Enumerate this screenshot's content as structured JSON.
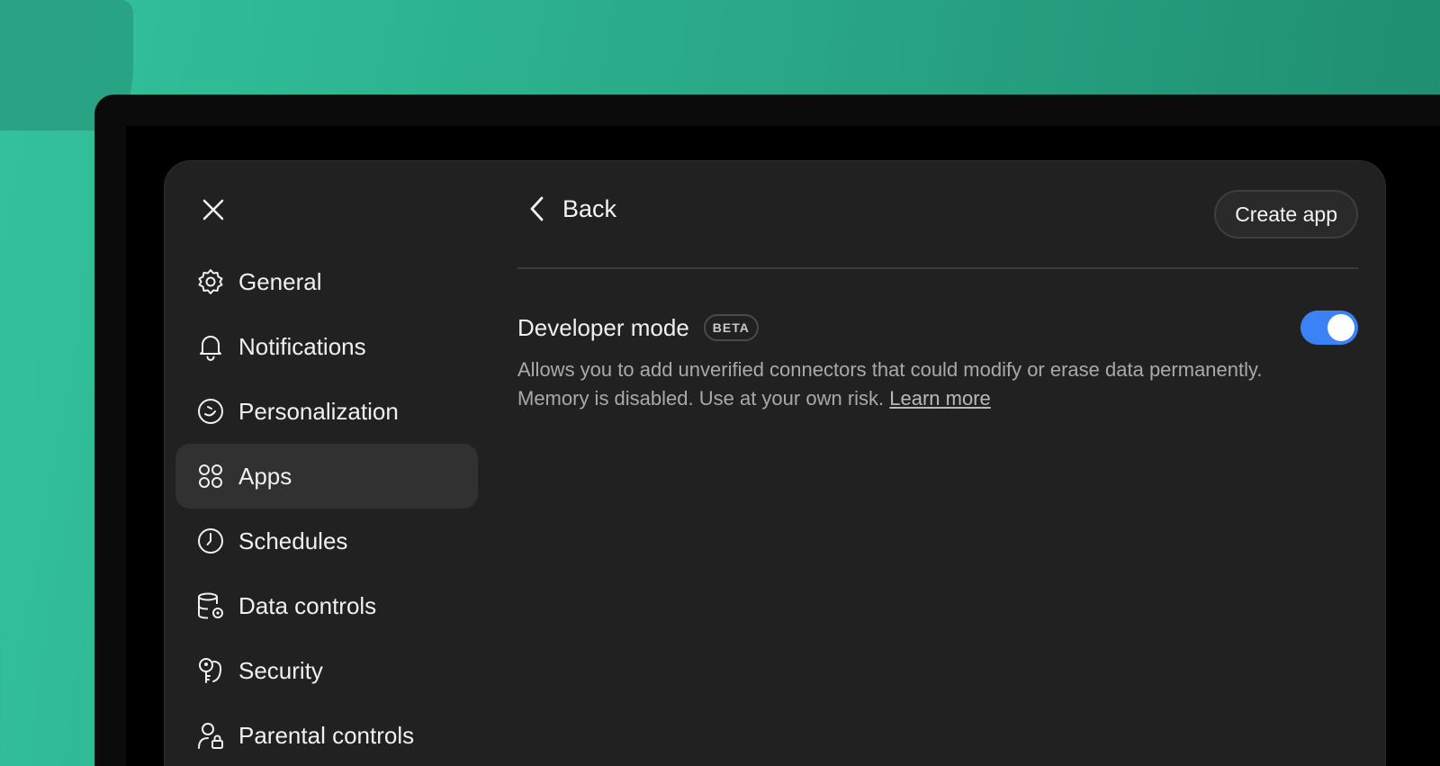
{
  "nav": {
    "items": [
      {
        "label": "General",
        "icon": "gear-icon"
      },
      {
        "label": "Notifications",
        "icon": "bell-icon"
      },
      {
        "label": "Personalization",
        "icon": "personalization-icon"
      },
      {
        "label": "Apps",
        "icon": "apps-grid-icon",
        "active": true
      },
      {
        "label": "Schedules",
        "icon": "clock-icon"
      },
      {
        "label": "Data controls",
        "icon": "database-gear-icon"
      },
      {
        "label": "Security",
        "icon": "key-icon"
      },
      {
        "label": "Parental controls",
        "icon": "parental-lock-icon"
      }
    ]
  },
  "header": {
    "back_label": "Back",
    "create_label": "Create app"
  },
  "developer_mode": {
    "title": "Developer mode",
    "badge": "BETA",
    "enabled": true,
    "description": "Allows you to add unverified connectors that could modify or erase data permanently. Memory is disabled. Use at your own risk.",
    "link_label": "Learn more"
  },
  "colors": {
    "toggle_on": "#3b82f6",
    "modal_bg": "#212121",
    "background_green": "#2aaa89"
  }
}
